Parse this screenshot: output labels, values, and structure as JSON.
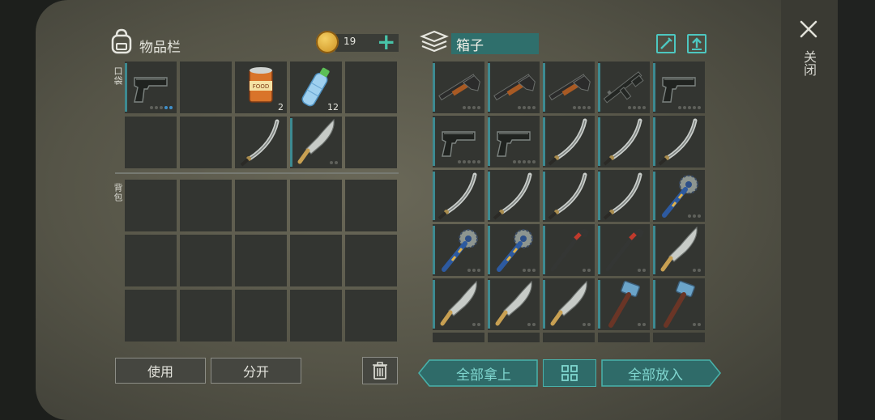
{
  "inventory": {
    "title": "物品栏",
    "coins": "19",
    "pocket_label": "口袋",
    "backpack_label": "背包"
  },
  "box": {
    "title": "箱子"
  },
  "close_label": "关闭",
  "buttons": {
    "use": "使用",
    "split": "分开",
    "take_all": "全部拿上",
    "put_all": "全部放入"
  },
  "pocket_items": [
    {
      "icon": "pistol",
      "qty": "",
      "bar": true,
      "dots": [
        "g",
        "g",
        "g",
        "b",
        "b"
      ]
    },
    {
      "icon": "",
      "qty": "",
      "bar": false,
      "dots": []
    },
    {
      "icon": "food-can",
      "qty": "2",
      "bar": false,
      "dots": []
    },
    {
      "icon": "water-bottle",
      "qty": "12",
      "bar": false,
      "dots": []
    },
    {
      "icon": "",
      "qty": "",
      "bar": false,
      "dots": []
    },
    {
      "icon": "",
      "qty": "",
      "bar": false,
      "dots": []
    },
    {
      "icon": "",
      "qty": "",
      "bar": false,
      "dots": []
    },
    {
      "icon": "katana",
      "qty": "",
      "bar": false,
      "dots": []
    },
    {
      "icon": "machete",
      "qty": "",
      "bar": true,
      "dots": [
        "g",
        "g"
      ]
    },
    {
      "icon": "",
      "qty": "",
      "bar": false,
      "dots": []
    }
  ],
  "box_items": [
    {
      "icon": "shotgun",
      "bar": true,
      "dots": [
        "g",
        "g",
        "g",
        "g"
      ]
    },
    {
      "icon": "shotgun",
      "bar": true,
      "dots": [
        "g",
        "g",
        "g",
        "g"
      ]
    },
    {
      "icon": "shotgun",
      "bar": true,
      "dots": [
        "g",
        "g",
        "g",
        "g"
      ]
    },
    {
      "icon": "assault-rifle",
      "bar": true,
      "dots": [
        "g",
        "g",
        "g",
        "g"
      ]
    },
    {
      "icon": "pistol",
      "bar": true,
      "dots": [
        "g",
        "g",
        "g",
        "g",
        "g"
      ]
    },
    {
      "icon": "pistol",
      "bar": true,
      "dots": [
        "g",
        "g",
        "g",
        "g",
        "g"
      ]
    },
    {
      "icon": "pistol",
      "bar": true,
      "dots": [
        "g",
        "g",
        "g",
        "g",
        "g"
      ]
    },
    {
      "icon": "katana",
      "bar": true,
      "dots": []
    },
    {
      "icon": "katana",
      "bar": true,
      "dots": []
    },
    {
      "icon": "katana",
      "bar": true,
      "dots": []
    },
    {
      "icon": "katana",
      "bar": true,
      "dots": []
    },
    {
      "icon": "katana",
      "bar": true,
      "dots": []
    },
    {
      "icon": "katana",
      "bar": true,
      "dots": []
    },
    {
      "icon": "katana",
      "bar": true,
      "dots": []
    },
    {
      "icon": "sawblade-club",
      "bar": true,
      "dots": [
        "g",
        "g",
        "g"
      ]
    },
    {
      "icon": "sawblade-club",
      "bar": true,
      "dots": [
        "g",
        "g",
        "g"
      ]
    },
    {
      "icon": "sawblade-club",
      "bar": true,
      "dots": [
        "g",
        "g",
        "g"
      ]
    },
    {
      "icon": "crowbar",
      "bar": true,
      "dots": [
        "g",
        "g"
      ]
    },
    {
      "icon": "crowbar",
      "bar": true,
      "dots": [
        "g",
        "g"
      ]
    },
    {
      "icon": "machete",
      "bar": true,
      "dots": [
        "g",
        "g"
      ]
    },
    {
      "icon": "machete",
      "bar": true,
      "dots": [
        "g",
        "g"
      ]
    },
    {
      "icon": "machete",
      "bar": true,
      "dots": [
        "g",
        "g"
      ]
    },
    {
      "icon": "machete",
      "bar": true,
      "dots": [
        "g",
        "g"
      ]
    },
    {
      "icon": "hammer",
      "bar": true,
      "dots": [
        "g",
        "g"
      ]
    },
    {
      "icon": "hammer",
      "bar": true,
      "dots": [
        "g",
        "g"
      ]
    }
  ],
  "colors": {
    "accent": "#3d8a91",
    "teal_button": "#2f6f6c",
    "teal_text": "#7fd6cf"
  }
}
